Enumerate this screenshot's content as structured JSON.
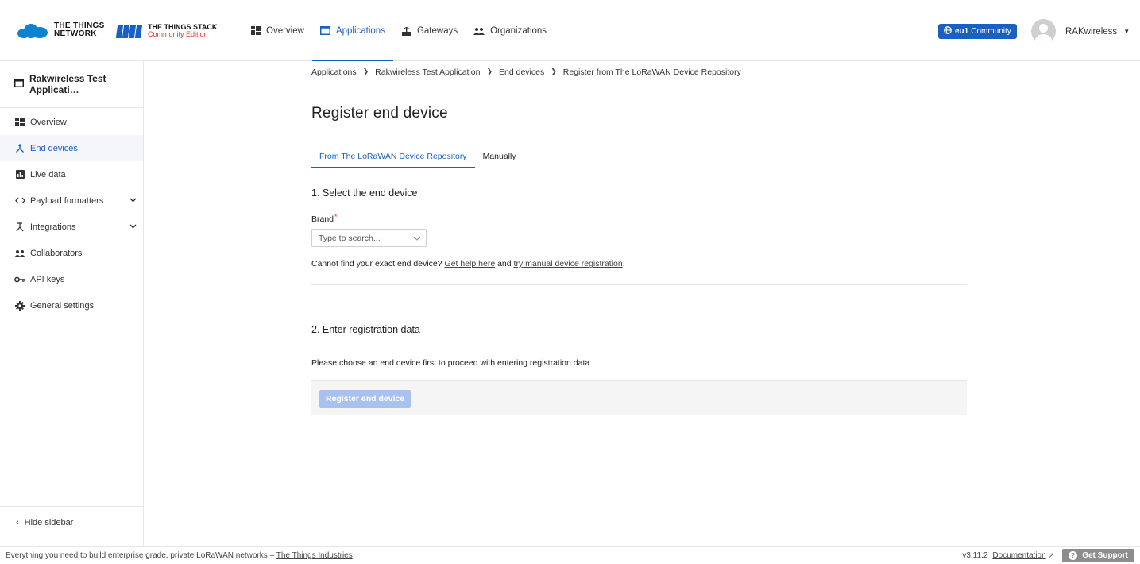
{
  "header": {
    "ttn_logo": "THE THINGS NETWORK",
    "tts_logo_line1": "THE THINGS STACK",
    "tts_logo_line2": "Community Edition",
    "nav": [
      {
        "label": "Overview",
        "icon": "grid-icon"
      },
      {
        "label": "Applications",
        "icon": "application-icon",
        "active": true
      },
      {
        "label": "Gateways",
        "icon": "gateway-icon"
      },
      {
        "label": "Organizations",
        "icon": "organization-icon"
      }
    ],
    "cluster": {
      "region": "eu1",
      "label": "Community"
    },
    "user": {
      "name": "RAKwireless"
    }
  },
  "sidebar": {
    "title": "Rakwireless Test Applicati…",
    "items": [
      {
        "label": "Overview",
        "icon": "grid-icon"
      },
      {
        "label": "End devices",
        "icon": "end-device-icon",
        "active": true
      },
      {
        "label": "Live data",
        "icon": "chart-icon"
      },
      {
        "label": "Payload formatters",
        "icon": "code-icon",
        "expandable": true
      },
      {
        "label": "Integrations",
        "icon": "integrations-icon",
        "expandable": true
      },
      {
        "label": "Collaborators",
        "icon": "people-icon"
      },
      {
        "label": "API keys",
        "icon": "key-icon"
      },
      {
        "label": "General settings",
        "icon": "gear-icon"
      }
    ],
    "hide_label": "Hide sidebar"
  },
  "breadcrumb": [
    "Applications",
    "Rakwireless Test Application",
    "End devices",
    "Register from The LoRaWAN Device Repository"
  ],
  "main": {
    "title": "Register end device",
    "tabs": [
      {
        "label": "From The LoRaWAN Device Repository",
        "active": true
      },
      {
        "label": "Manually"
      }
    ],
    "section1_title": "1. Select the end device",
    "brand_label": "Brand",
    "brand_required": "*",
    "brand_placeholder": "Type to search...",
    "help_prefix": "Cannot find your exact end device? ",
    "help_link1": "Get help here",
    "help_mid": " and ",
    "help_link2": "try manual device registration",
    "help_suffix": ".",
    "section2_title": "2. Enter registration data",
    "choose_text": "Please choose an end device first to proceed with entering registration data",
    "submit_label": "Register end device"
  },
  "footer": {
    "tagline": "Everything you need to build enterprise grade, private LoRaWAN networks – ",
    "company": "The Things Industries",
    "version": "v3.11.2",
    "docs": "Documentation",
    "support": "Get Support"
  },
  "colors": {
    "accent": "#1a5fc2",
    "required": "#e0362c",
    "disabled_button": "#a9c1ef"
  }
}
